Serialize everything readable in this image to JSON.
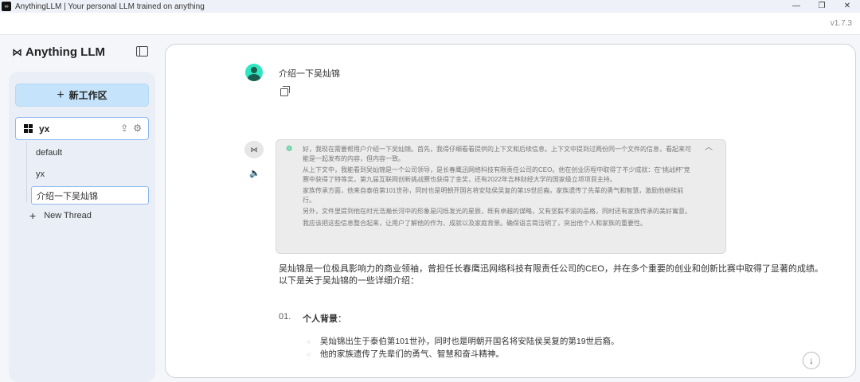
{
  "window": {
    "title": "AnythingLLM | Your personal LLM trained on anything",
    "version": "v1.7.3"
  },
  "sidebar": {
    "logo": "Anything LLM",
    "new_workspace": "新工作区",
    "workspace": "yx",
    "threads": [
      "default",
      "yx",
      "介绍一下吴灿锦"
    ],
    "new_thread": "New Thread"
  },
  "chat": {
    "user_message": "介绍一下吴灿锦",
    "thinking": [
      "好，我现在需要帮用户介绍一下吴灿锦。首先，我得仔细看看提供的上下文和后续信息。上下文中提到过两份同一个文件的信息，看起来可能是一起发布的内容，但内容一致。",
      "从上下文中，我能看到吴灿锦是一个公司领导，是长春鹰迅网络科技有限责任公司的CEO。他在创业历程中取得了不少成就：在“挑战杯”竞赛中获得了特等奖，第九届互联网创新挑战赛也获得了金奖，还有2022年吉林财经大学的国家级立项项目主持。",
      "家族传承方面，他来自泰伯第101世孙，同时也是明朝开国名将安陆侯吴复的第19世后裔。家族遗传了先辈的勇气和智慧，激励他继续前行。",
      "另外，文件里提到他在时光浩瀚长河中的形象是闪烁发光的星辰，既有卓越的谋略，又有坚毅不渝的品格，同时还有家族传承的美好寓意。",
      "我应该把这些信息整合起来，让用户了解他的作为、成就以及家庭背景。确保语言简洁明了，突出他个人和家族的重要性。"
    ],
    "answer_lines": [
      "吴灿锦是一位极具影响力的商业领袖，曾担任长春鹰迅网络科技有限责任公司的CEO，并在多个重要的创业和创新比赛中取得了显著的成绩。",
      "以下是关于吴灿锦的一些详细介绍："
    ],
    "section": {
      "num": "01.",
      "title": "个人背景",
      "colon": "："
    },
    "bullets": [
      "吴灿锦出生于泰伯第101世孙，同时也是明朝开国名将安陆侯吴复的第19世后裔。",
      "他的家族遗传了先辈们的勇气、智慧和奋斗精神。"
    ]
  }
}
